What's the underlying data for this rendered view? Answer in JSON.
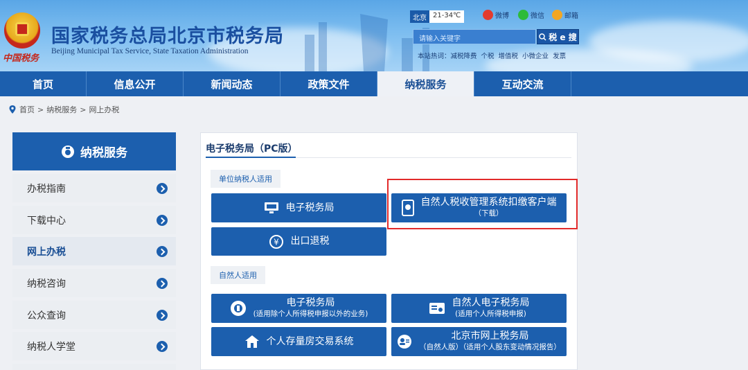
{
  "header": {
    "title": "国家税务总局北京市税务局",
    "subtitle": "Beijing Municipal Tax Service, State Taxation Administration",
    "brand": "中国税务",
    "weather": {
      "city": "北京",
      "temp": "21-34℃"
    },
    "social": [
      "微博",
      "微信",
      "邮箱"
    ],
    "search": {
      "placeholder": "请输入关键字",
      "button": "税 e 搜"
    },
    "hotwords": [
      "本站热词：减税降费",
      "个税",
      "增值税",
      "小微企业",
      "发票"
    ]
  },
  "nav": [
    "首页",
    "信息公开",
    "新闻动态",
    "政策文件",
    "纳税服务",
    "互动交流"
  ],
  "nav_active": "纳税服务",
  "breadcrumb": [
    "首页",
    "纳税服务",
    "网上办税"
  ],
  "sidebar": {
    "title": "纳税服务",
    "items": [
      "办税指南",
      "下载中心",
      "网上办税",
      "纳税咨询",
      "公众查询",
      "纳税人学堂"
    ],
    "active": "网上办税"
  },
  "content": {
    "title": "电子税务局（PC版）",
    "section1_tag": "单位纳税人适用",
    "section2_tag": "自然人适用",
    "buttons": {
      "etax": "电子税务局",
      "export": "出口退税",
      "client_main": "自然人税收管理系统扣缴客户端",
      "client_sub": "（下载）",
      "etax2_main": "电子税务局",
      "etax2_sub": "(适用除个人所得税申报以外的业务)",
      "natural_main": "自然人电子税务局",
      "natural_sub": "(适用个人所得税申报)",
      "housing": "个人存量房交易系统",
      "bj_main": "北京市网上税务局",
      "bj_sub": "（自然人版）（适用个人股东变动情况报告）"
    }
  },
  "colors": {
    "primary": "#1c5fae",
    "highlight": "#e22a2a"
  }
}
